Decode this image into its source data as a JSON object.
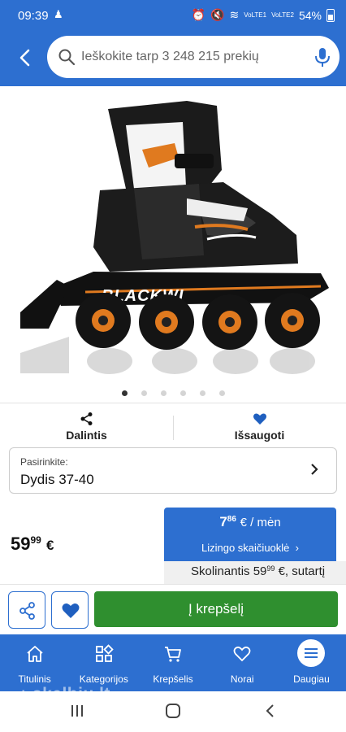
{
  "status_bar": {
    "time": "09:39",
    "net1": "VoLTE1",
    "net2": "VoLTE2",
    "battery": "54%"
  },
  "search": {
    "placeholder": "Ieškokite tarp 3 248 215 prekių"
  },
  "gallery": {
    "total_images": 6,
    "active_index": 0
  },
  "actions": {
    "share_label": "Dalintis",
    "save_label": "Išsaugoti"
  },
  "variant": {
    "label": "Pasirinkite:",
    "value": "Dydis 37-40"
  },
  "price": {
    "whole": "59",
    "cents": "99",
    "currency": "€"
  },
  "leasing": {
    "monthly_whole": "7",
    "monthly_cents": "86",
    "monthly_unit": "€ / mėn",
    "calculator_label": "Lizingo skaičiuoklė",
    "note_prefix": "Skolinantis 59",
    "note_cents": "99",
    "note_suffix": " €, sutartį"
  },
  "buy": {
    "cart_label": "Į krepšelį"
  },
  "tabbar": {
    "items": [
      {
        "label": "Titulinis",
        "icon": "home-icon"
      },
      {
        "label": "Kategorijos",
        "icon": "categories-icon"
      },
      {
        "label": "Krepšelis",
        "icon": "cart-icon"
      },
      {
        "label": "Norai",
        "icon": "heart-icon"
      },
      {
        "label": "Daugiau",
        "icon": "menu-icon"
      }
    ]
  },
  "watermark": "skelbiu.lt",
  "colors": {
    "brand_blue": "#2d6fd0",
    "cart_green": "#2f8f2f"
  }
}
